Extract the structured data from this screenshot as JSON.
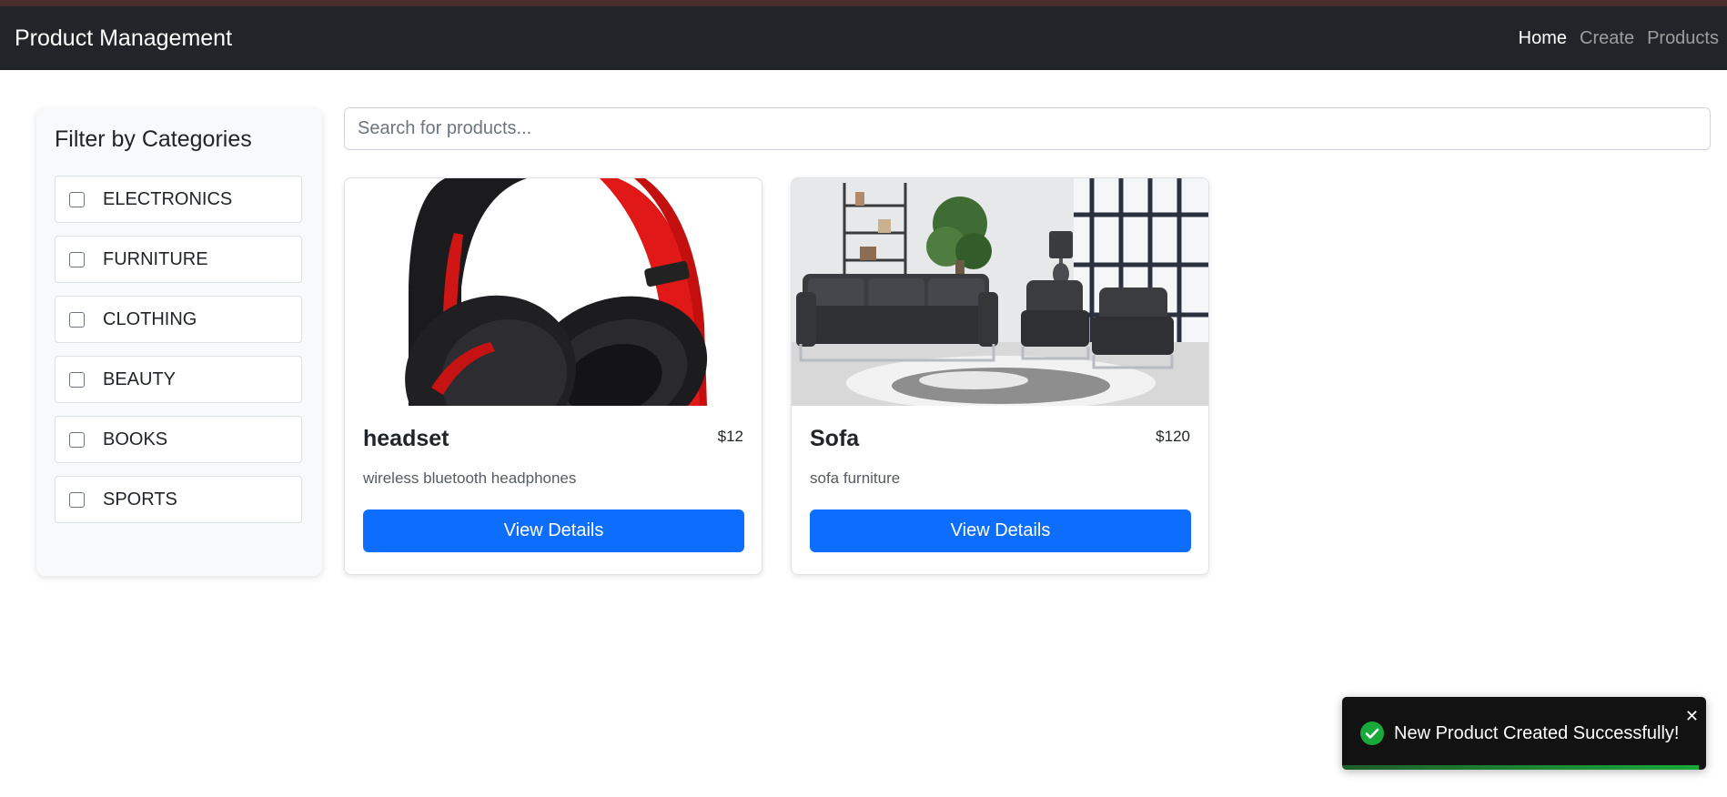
{
  "navbar": {
    "brand": "Product Management",
    "links": [
      {
        "label": "Home",
        "active": true
      },
      {
        "label": "Create",
        "active": false
      },
      {
        "label": "Products",
        "active": false
      }
    ]
  },
  "sidebar": {
    "title": "Filter by Categories",
    "categories": [
      {
        "label": "ELECTRONICS",
        "checked": false
      },
      {
        "label": "FURNITURE",
        "checked": false
      },
      {
        "label": "CLOTHING",
        "checked": false
      },
      {
        "label": "BEAUTY",
        "checked": false
      },
      {
        "label": "BOOKS",
        "checked": false
      },
      {
        "label": "SPORTS",
        "checked": false
      }
    ]
  },
  "search": {
    "placeholder": "Search for products...",
    "value": ""
  },
  "products": [
    {
      "name": "headset",
      "price": "$12",
      "description": "wireless bluetooth headphones",
      "button": "View Details"
    },
    {
      "name": "Sofa",
      "price": "$120",
      "description": "sofa furniture",
      "button": "View Details"
    }
  ],
  "toast": {
    "message": "New Product Created Successfully!",
    "close": "✕",
    "progress": 0.98,
    "icon": "check-circle-icon"
  },
  "colors": {
    "navbar_bg": "#212529",
    "primary": "#0d6efd",
    "success": "#19a83a"
  }
}
